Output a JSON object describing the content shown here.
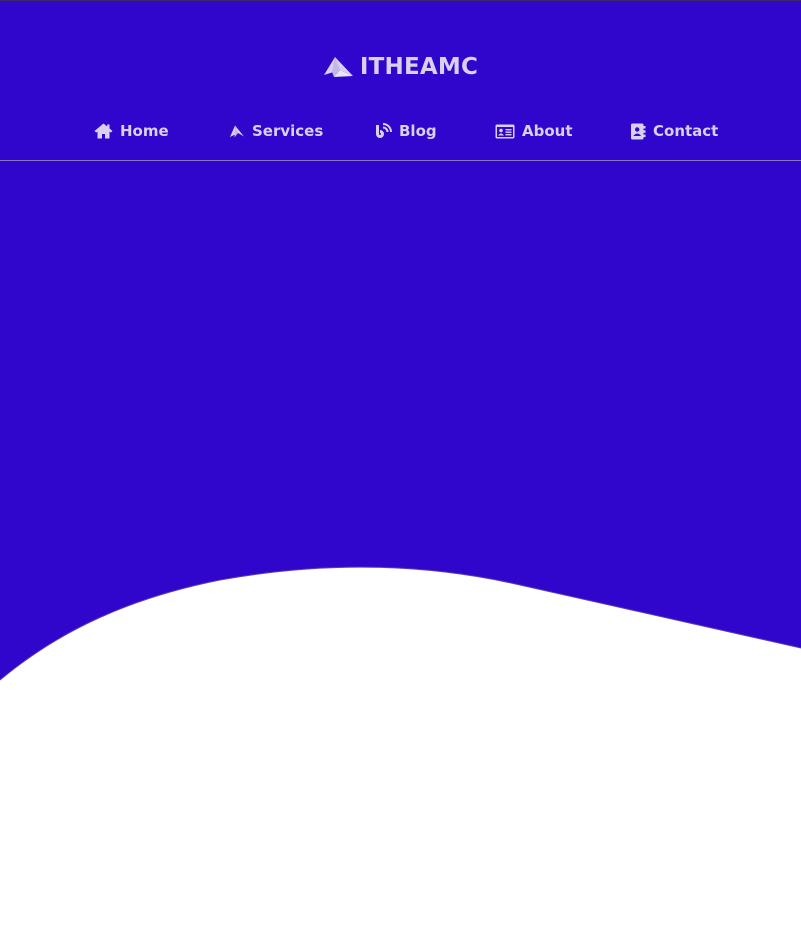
{
  "brand": {
    "name": "ITHEAMC",
    "logo_icon": "paper-plane-logo-icon"
  },
  "nav": {
    "items": [
      {
        "label": "Home",
        "icon": "home-icon"
      },
      {
        "label": "Services",
        "icon": "paper-plane-icon"
      },
      {
        "label": "Blog",
        "icon": "rss-icon"
      },
      {
        "label": "About",
        "icon": "id-card-icon"
      },
      {
        "label": "Contact",
        "icon": "address-book-icon"
      }
    ]
  },
  "colors": {
    "hero_background": "#3005cc",
    "nav_text": "#d9cfee",
    "divider": "#8876c9",
    "page_background": "#ffffff"
  }
}
